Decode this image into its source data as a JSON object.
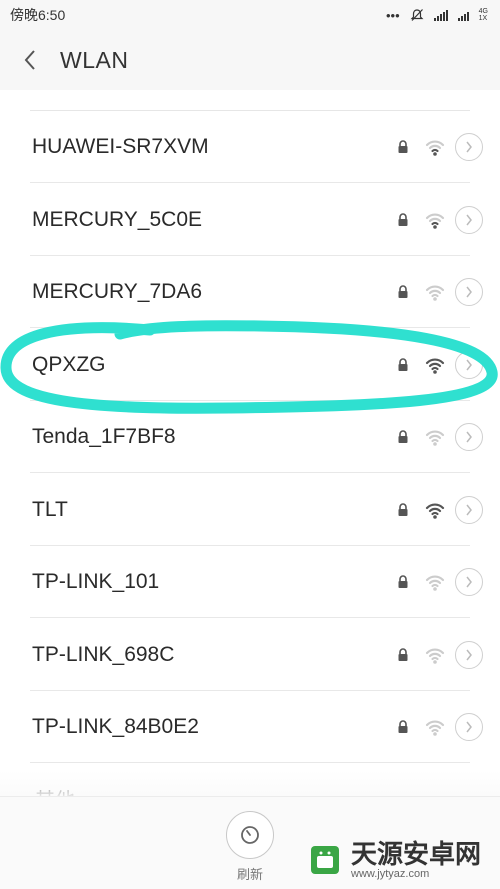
{
  "status_bar": {
    "time": "傍晚6:50",
    "icons": [
      "more-dots-icon",
      "mute-bell-icon",
      "signal-bars-icon",
      "signal-4g-icon"
    ],
    "network_type": "4G",
    "network_sub": "1X"
  },
  "header": {
    "back_icon": "chevron-left-icon",
    "title": "WLAN"
  },
  "networks": [
    {
      "ssid": "HUAWEI-SR7XVM",
      "locked": true,
      "strength": "weak"
    },
    {
      "ssid": "MERCURY_5C0E",
      "locked": true,
      "strength": "weak"
    },
    {
      "ssid": "MERCURY_7DA6",
      "locked": true,
      "strength": "very-weak"
    },
    {
      "ssid": "QPXZG",
      "locked": true,
      "strength": "strong",
      "highlighted": true
    },
    {
      "ssid": "Tenda_1F7BF8",
      "locked": true,
      "strength": "very-weak"
    },
    {
      "ssid": "TLT",
      "locked": true,
      "strength": "strong"
    },
    {
      "ssid": "TP-LINK_101",
      "locked": true,
      "strength": "very-weak"
    },
    {
      "ssid": "TP-LINK_698C",
      "locked": true,
      "strength": "very-weak"
    },
    {
      "ssid": "TP-LINK_84B0E2",
      "locked": true,
      "strength": "very-weak"
    }
  ],
  "partial_item": {
    "label": "其他"
  },
  "bottom": {
    "refresh_label": "刷新",
    "refresh_icon": "refresh-icon"
  },
  "watermark": {
    "text_cn": "天源安卓网",
    "url": "www.jytyaz.com"
  },
  "colors": {
    "annotation": "#2fe0d0",
    "wifi_strong": "#555555",
    "wifi_weak": "#cccccc"
  }
}
